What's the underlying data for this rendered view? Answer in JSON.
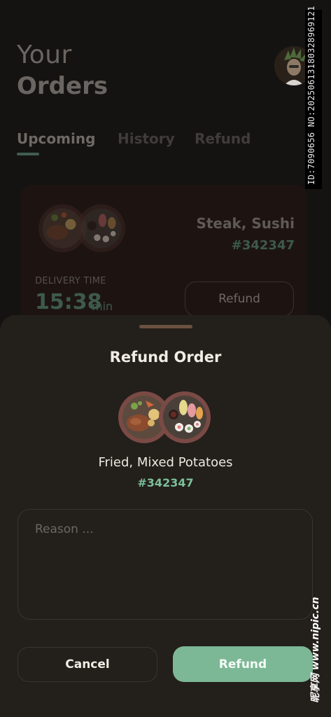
{
  "header": {
    "title_line1": "Your",
    "title_line2": "Orders"
  },
  "tabs": [
    {
      "label": "Upcoming",
      "active": true
    },
    {
      "label": "History",
      "active": false
    },
    {
      "label": "Refund",
      "active": false
    }
  ],
  "order_card": {
    "name": "Steak, Sushi",
    "order_id": "#342347",
    "delivery_label": "DELIVERY TIME",
    "time": "15:38",
    "time_unit": "min",
    "refund_label": "Refund"
  },
  "refund_sheet": {
    "title": "Refund Order",
    "item_name": "Fried, Mixed Potatoes",
    "order_id": "#342347",
    "reason_placeholder": "Reason ...",
    "cancel_label": "Cancel",
    "refund_label": "Refund"
  },
  "watermark": {
    "id_text": "ID:7090656 NO:20250613180328969121",
    "site_text": "昵享网 www.nipic.cn"
  },
  "colors": {
    "accent_green": "#7cb895",
    "background": "#141312",
    "sheet": "#231f1b"
  },
  "icons": [
    "avatar-icon",
    "steak-plate-icon",
    "sushi-plate-icon"
  ]
}
